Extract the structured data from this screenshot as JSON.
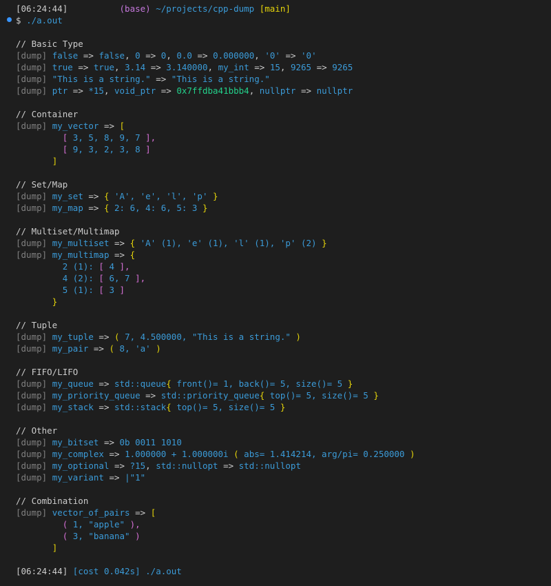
{
  "colors": {
    "background": "#1e1e1e",
    "text": "#cccccc",
    "dump_tag": "#808080",
    "variable": "#3b9bd8",
    "bracket": "#e5d40a",
    "inner_bracket": "#d670d6",
    "pointer_address": "#23d18b",
    "conda_env": "#c678dd",
    "prompt_dot": "#3794ff"
  },
  "icons": {
    "prompt_marker": "circle-dot-icon"
  },
  "lines": [
    [
      [
        "[06:24:44]",
        "w"
      ],
      [
        "          ",
        "w"
      ],
      [
        "(base)",
        "p"
      ],
      [
        " ~/projects/cpp-dump ",
        "b"
      ],
      [
        "[main]",
        "y"
      ]
    ],
    [
      [
        "$ ",
        "w"
      ],
      [
        "./a.out",
        "b"
      ]
    ],
    [],
    [
      [
        "// Basic Type",
        "w"
      ]
    ],
    [
      [
        "[dump] ",
        "g"
      ],
      [
        "false",
        "b"
      ],
      [
        " => ",
        "w"
      ],
      [
        "false",
        "b"
      ],
      [
        ", ",
        "w"
      ],
      [
        "0",
        "b"
      ],
      [
        " => ",
        "w"
      ],
      [
        "0",
        "b"
      ],
      [
        ", ",
        "w"
      ],
      [
        "0.0",
        "b"
      ],
      [
        " => ",
        "w"
      ],
      [
        "0.000000",
        "b"
      ],
      [
        ", ",
        "w"
      ],
      [
        "'0'",
        "b"
      ],
      [
        " => ",
        "w"
      ],
      [
        "'0'",
        "b"
      ]
    ],
    [
      [
        "[dump] ",
        "g"
      ],
      [
        "true",
        "b"
      ],
      [
        " => ",
        "w"
      ],
      [
        "true",
        "b"
      ],
      [
        ", ",
        "w"
      ],
      [
        "3.14",
        "b"
      ],
      [
        " => ",
        "w"
      ],
      [
        "3.140000",
        "b"
      ],
      [
        ", ",
        "w"
      ],
      [
        "my_int",
        "b"
      ],
      [
        " => ",
        "w"
      ],
      [
        "15",
        "b"
      ],
      [
        ", ",
        "w"
      ],
      [
        "9265",
        "b"
      ],
      [
        " => ",
        "w"
      ],
      [
        "9265",
        "b"
      ]
    ],
    [
      [
        "[dump] ",
        "g"
      ],
      [
        "\"This is a string.\"",
        "b"
      ],
      [
        " => ",
        "w"
      ],
      [
        "\"This is a string.\"",
        "b"
      ]
    ],
    [
      [
        "[dump] ",
        "g"
      ],
      [
        "ptr",
        "b"
      ],
      [
        " => ",
        "w"
      ],
      [
        "*15",
        "b"
      ],
      [
        ", ",
        "w"
      ],
      [
        "void_ptr",
        "b"
      ],
      [
        " => ",
        "w"
      ],
      [
        "0x7ffdba41bbb4",
        "G"
      ],
      [
        ", ",
        "w"
      ],
      [
        "nullptr",
        "b"
      ],
      [
        " => ",
        "w"
      ],
      [
        "nullptr",
        "b"
      ]
    ],
    [],
    [
      [
        "// Container",
        "w"
      ]
    ],
    [
      [
        "[dump] ",
        "g"
      ],
      [
        "my_vector",
        "b"
      ],
      [
        " => ",
        "w"
      ],
      [
        "[",
        "y"
      ]
    ],
    [
      [
        "         ",
        "w"
      ],
      [
        "[",
        "m"
      ],
      [
        " 3, 5, 8, 9, 7 ",
        "b"
      ],
      [
        "],",
        "m"
      ]
    ],
    [
      [
        "         ",
        "w"
      ],
      [
        "[",
        "m"
      ],
      [
        " 9, 3, 2, 3, 8 ",
        "b"
      ],
      [
        "]",
        "m"
      ]
    ],
    [
      [
        "       ",
        "w"
      ],
      [
        "]",
        "y"
      ]
    ],
    [],
    [
      [
        "// Set/Map",
        "w"
      ]
    ],
    [
      [
        "[dump] ",
        "g"
      ],
      [
        "my_set",
        "b"
      ],
      [
        " => ",
        "w"
      ],
      [
        "{",
        "y"
      ],
      [
        " 'A', 'e', 'l', 'p' ",
        "b"
      ],
      [
        "}",
        "y"
      ]
    ],
    [
      [
        "[dump] ",
        "g"
      ],
      [
        "my_map",
        "b"
      ],
      [
        " => ",
        "w"
      ],
      [
        "{",
        "y"
      ],
      [
        " 2: 6, 4: 6, 5: 3 ",
        "b"
      ],
      [
        "}",
        "y"
      ]
    ],
    [],
    [
      [
        "// Multiset/Multimap",
        "w"
      ]
    ],
    [
      [
        "[dump] ",
        "g"
      ],
      [
        "my_multiset",
        "b"
      ],
      [
        " => ",
        "w"
      ],
      [
        "{",
        "y"
      ],
      [
        " 'A' (1), 'e' (1), 'l' (1), 'p' (2) ",
        "b"
      ],
      [
        "}",
        "y"
      ]
    ],
    [
      [
        "[dump] ",
        "g"
      ],
      [
        "my_multimap",
        "b"
      ],
      [
        " => ",
        "w"
      ],
      [
        "{",
        "y"
      ]
    ],
    [
      [
        "         ",
        "w"
      ],
      [
        "2 (1): ",
        "b"
      ],
      [
        "[",
        "m"
      ],
      [
        " 4 ",
        "b"
      ],
      [
        "],",
        "m"
      ]
    ],
    [
      [
        "         ",
        "w"
      ],
      [
        "4 (2): ",
        "b"
      ],
      [
        "[",
        "m"
      ],
      [
        " 6, 7 ",
        "b"
      ],
      [
        "],",
        "m"
      ]
    ],
    [
      [
        "         ",
        "w"
      ],
      [
        "5 (1): ",
        "b"
      ],
      [
        "[",
        "m"
      ],
      [
        " 3 ",
        "b"
      ],
      [
        "]",
        "m"
      ]
    ],
    [
      [
        "       ",
        "w"
      ],
      [
        "}",
        "y"
      ]
    ],
    [],
    [
      [
        "// Tuple",
        "w"
      ]
    ],
    [
      [
        "[dump] ",
        "g"
      ],
      [
        "my_tuple",
        "b"
      ],
      [
        " => ",
        "w"
      ],
      [
        "(",
        "y"
      ],
      [
        " 7, 4.500000, \"This is a string.\" ",
        "b"
      ],
      [
        ")",
        "y"
      ]
    ],
    [
      [
        "[dump] ",
        "g"
      ],
      [
        "my_pair",
        "b"
      ],
      [
        " => ",
        "w"
      ],
      [
        "(",
        "y"
      ],
      [
        " 8, 'a' ",
        "b"
      ],
      [
        ")",
        "y"
      ]
    ],
    [],
    [
      [
        "// FIFO/LIFO",
        "w"
      ]
    ],
    [
      [
        "[dump] ",
        "g"
      ],
      [
        "my_queue",
        "b"
      ],
      [
        " => ",
        "w"
      ],
      [
        "std::queue",
        "b"
      ],
      [
        "{",
        "y"
      ],
      [
        " front()= 1, back()= 5, size()= 5 ",
        "b"
      ],
      [
        "}",
        "y"
      ]
    ],
    [
      [
        "[dump] ",
        "g"
      ],
      [
        "my_priority_queue",
        "b"
      ],
      [
        " => ",
        "w"
      ],
      [
        "std::priority_queue",
        "b"
      ],
      [
        "{",
        "y"
      ],
      [
        " top()= 5, size()= 5 ",
        "b"
      ],
      [
        "}",
        "y"
      ]
    ],
    [
      [
        "[dump] ",
        "g"
      ],
      [
        "my_stack",
        "b"
      ],
      [
        " => ",
        "w"
      ],
      [
        "std::stack",
        "b"
      ],
      [
        "{",
        "y"
      ],
      [
        " top()= 5, size()= 5 ",
        "b"
      ],
      [
        "}",
        "y"
      ]
    ],
    [],
    [
      [
        "// Other",
        "w"
      ]
    ],
    [
      [
        "[dump] ",
        "g"
      ],
      [
        "my_bitset",
        "b"
      ],
      [
        " => ",
        "w"
      ],
      [
        "0b 0011 1010",
        "b"
      ]
    ],
    [
      [
        "[dump] ",
        "g"
      ],
      [
        "my_complex",
        "b"
      ],
      [
        " => ",
        "w"
      ],
      [
        "1.000000 + 1.000000i ",
        "b"
      ],
      [
        "(",
        "y"
      ],
      [
        " abs= 1.414214, arg/pi= 0.250000 ",
        "b"
      ],
      [
        ")",
        "y"
      ]
    ],
    [
      [
        "[dump] ",
        "g"
      ],
      [
        "my_optional",
        "b"
      ],
      [
        " => ",
        "w"
      ],
      [
        "?15",
        "b"
      ],
      [
        ", ",
        "w"
      ],
      [
        "std::nullopt",
        "b"
      ],
      [
        " => ",
        "w"
      ],
      [
        "std::nullopt",
        "b"
      ]
    ],
    [
      [
        "[dump] ",
        "g"
      ],
      [
        "my_variant",
        "b"
      ],
      [
        " => ",
        "w"
      ],
      [
        "|\"1\"",
        "b"
      ]
    ],
    [],
    [
      [
        "// Combination",
        "w"
      ]
    ],
    [
      [
        "[dump] ",
        "g"
      ],
      [
        "vector_of_pairs",
        "b"
      ],
      [
        " => ",
        "w"
      ],
      [
        "[",
        "y"
      ]
    ],
    [
      [
        "         ",
        "w"
      ],
      [
        "(",
        "m"
      ],
      [
        " 1, \"apple\" ",
        "b"
      ],
      [
        "),",
        "m"
      ]
    ],
    [
      [
        "         ",
        "w"
      ],
      [
        "(",
        "m"
      ],
      [
        " 3, \"banana\" ",
        "b"
      ],
      [
        ")",
        "m"
      ]
    ],
    [
      [
        "       ",
        "w"
      ],
      [
        "]",
        "y"
      ]
    ],
    [],
    [
      [
        "[06:24:44]",
        "w"
      ],
      [
        " [cost 0.042s] ",
        "b"
      ],
      [
        "./a.out",
        "b"
      ]
    ]
  ]
}
